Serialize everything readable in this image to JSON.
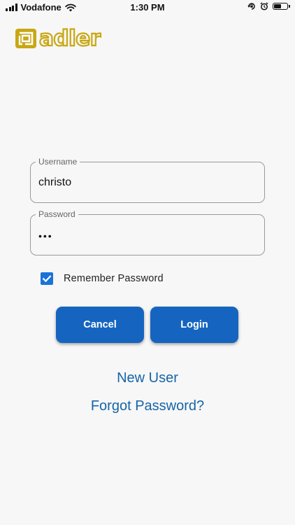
{
  "status_bar": {
    "carrier": "Vodafone",
    "time": "1:30 PM",
    "battery_level": 0.6
  },
  "brand": {
    "name": "adler",
    "color": "#c9a714"
  },
  "form": {
    "username": {
      "label": "Username",
      "value": "christo"
    },
    "password": {
      "label": "Password",
      "value": "•••"
    },
    "remember": {
      "label": "Remember Password",
      "checked": true
    }
  },
  "buttons": {
    "cancel": "Cancel",
    "login": "Login"
  },
  "links": {
    "new_user": "New User",
    "forgot_password": "Forgot Password?"
  },
  "colors": {
    "primary": "#1565c0",
    "link": "#1565a8",
    "checkbox": "#1a73d9",
    "background": "#f7f7f7"
  },
  "icons": [
    "signal-icon",
    "wifi-icon",
    "rotation-lock-icon",
    "alarm-icon",
    "battery-icon",
    "adler-logo-icon",
    "checkmark-icon"
  ]
}
